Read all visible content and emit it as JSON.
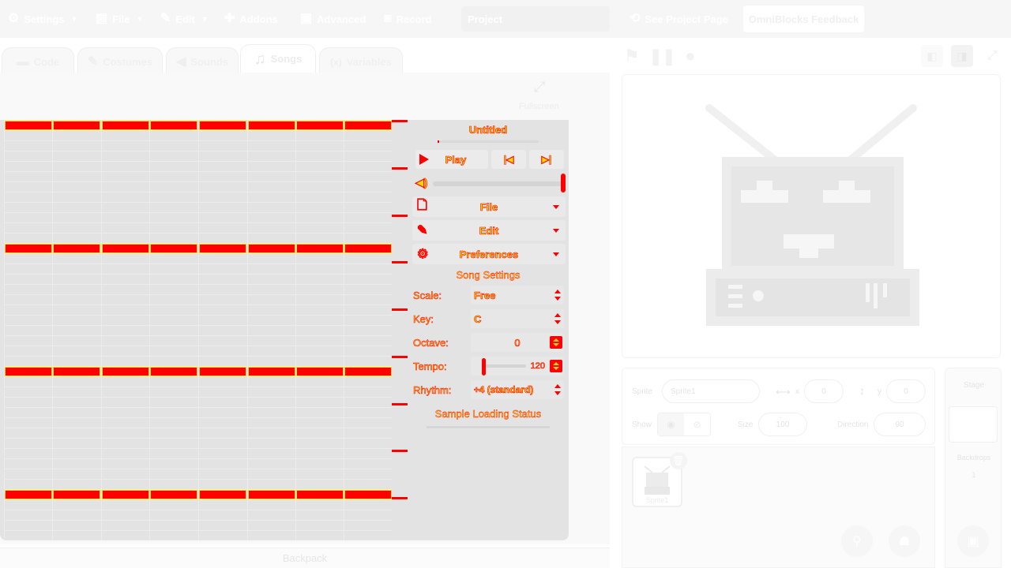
{
  "menubar": {
    "settings": "Settings",
    "file": "File",
    "edit": "Edit",
    "addons": "Addons",
    "advanced": "Advanced",
    "record": "Record",
    "project_placeholder": "Project",
    "see_project_page": "See Project Page",
    "feedback": "OmniBlocks Feedback"
  },
  "tabs": {
    "code": "Code",
    "costumes": "Costumes",
    "sounds": "Sounds",
    "songs": "Songs",
    "variables": "Variables"
  },
  "workspace": {
    "fullscreen_label": "Fullscreen"
  },
  "song_editor": {
    "title": "Untitled",
    "play_label": "Play",
    "file_label": "File",
    "edit_label": "Edit",
    "preferences_label": "Preferences",
    "song_settings_title": "Song Settings",
    "scale_label": "Scale:",
    "scale_value": "Free",
    "key_label": "Key:",
    "key_value": "C",
    "octave_label": "Octave:",
    "octave_value": "0",
    "tempo_label": "Tempo:",
    "tempo_value": "120",
    "rhythm_label": "Rhythm:",
    "rhythm_value": "÷4 (standard)",
    "sample_status": "Sample Loading Status",
    "volume_level": 1.0
  },
  "backpack": "Backpack",
  "sprite_info": {
    "sprite_label": "Sprite",
    "sprite_name": "Sprite1",
    "x_label": "x",
    "x_value": "0",
    "y_label": "y",
    "y_value": "0",
    "show_label": "Show",
    "size_label": "Size",
    "size_value": "100",
    "direction_label": "Direction",
    "direction_value": "90"
  },
  "sprite_list": {
    "sprite_name": "Sprite1"
  },
  "stage_panel": {
    "title": "Stage",
    "backdrops_label": "Backdrops",
    "backdrops_count": "1"
  },
  "colors": {
    "accent_red": "#ff0000",
    "outline_yellow": "#ffd800",
    "panel_gray": "#e3e3e3"
  }
}
